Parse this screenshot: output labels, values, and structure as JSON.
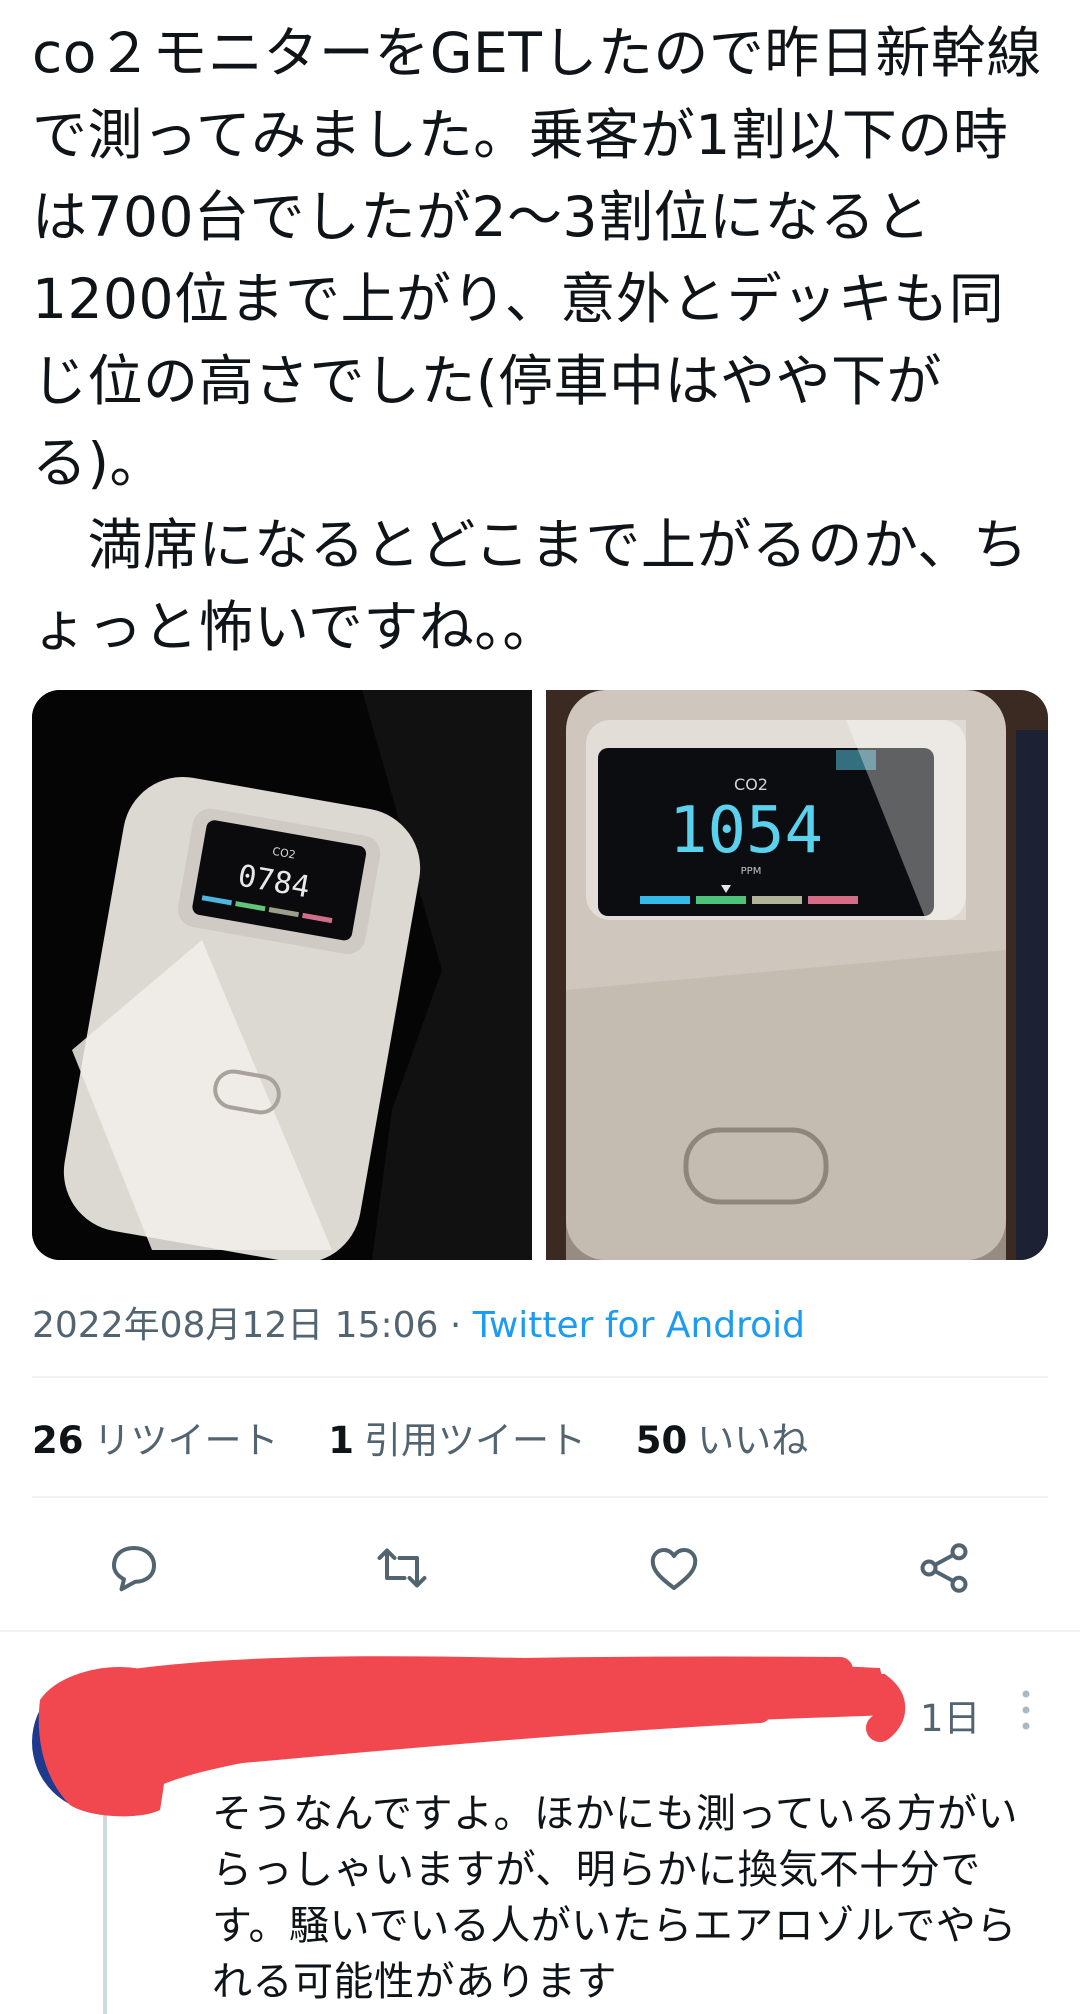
{
  "tweet": {
    "text": "co２モニターをGETしたので昨日新幹線で測ってみました。乗客が1割以下の時は700台でしたが2〜3割位になると1200位まで上がり、意外とデッキも同じ位の高さでした(停車中はやや下がる)。\n　満席になるとどこまで上がるのか、ちょっと怖いですね。。",
    "timestamp": "2022年08月12日 15:06",
    "separator": " · ",
    "source": "Twitter for Android"
  },
  "media": {
    "left_reading": "0784",
    "right_reading": "1054",
    "co2_label": "CO2",
    "ppm_label": "PPM"
  },
  "stats": [
    {
      "count": "26",
      "label": "リツイート"
    },
    {
      "count": "1",
      "label": "引用ツイート"
    },
    {
      "count": "50",
      "label": "いいね"
    }
  ],
  "actions": [
    {
      "icon": "reply-icon"
    },
    {
      "icon": "retweet-icon"
    },
    {
      "icon": "like-icon"
    },
    {
      "icon": "share-icon"
    }
  ],
  "reply": {
    "time": "1日",
    "text": "そうなんですよ。ほかにも測っている方がいらっしゃいますが、明らかに換気不十分です。騒いでいる人がいたらエアロゾルでやられる可能性があります"
  },
  "colors": {
    "accent": "#1d9bf0",
    "secondary_text": "#536471",
    "redaction": "#f0484e"
  }
}
